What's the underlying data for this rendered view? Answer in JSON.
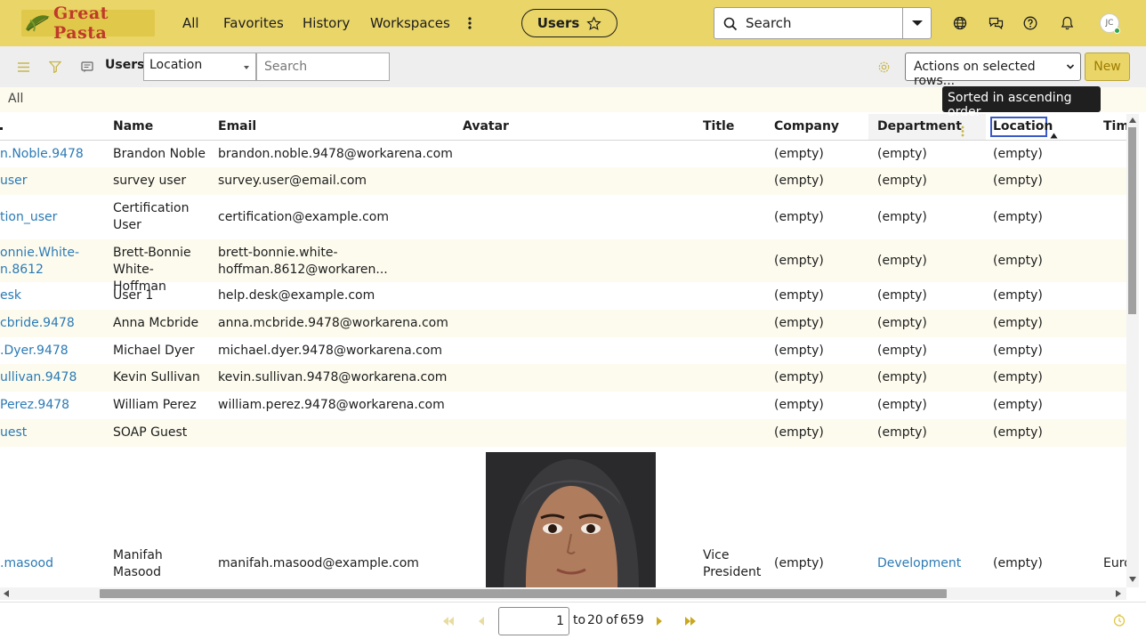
{
  "header": {
    "logo_text": "Great Pasta",
    "nav": [
      "All",
      "Favorites",
      "History",
      "Workspaces"
    ],
    "current_module": "Users",
    "search_placeholder": "Search",
    "user_initials": "JC"
  },
  "listbar": {
    "title": "Users",
    "field_select": "Location",
    "search_placeholder": "Search",
    "actions_label": "Actions on selected rows...",
    "new_label": "New"
  },
  "breadcrumb": "All",
  "tooltip": "Sorted in ascending order",
  "columns": [
    "Name",
    "Email",
    "Avatar",
    "Title",
    "Company",
    "Department",
    "Location",
    "Tim"
  ],
  "rows": [
    {
      "id": "n.Noble.9478",
      "name": "Brandon Noble",
      "email": "brandon.noble.9478@workarena.com",
      "title": "",
      "company": "(empty)",
      "department": "(empty)",
      "location": "(empty)"
    },
    {
      "id": "user",
      "name": "survey user",
      "email": "survey.user@email.com",
      "title": "",
      "company": "(empty)",
      "department": "(empty)",
      "location": "(empty)"
    },
    {
      "id": "tion_user",
      "name": "Certification User",
      "email": "certification@example.com",
      "title": "",
      "company": "(empty)",
      "department": "(empty)",
      "location": "(empty)"
    },
    {
      "id": "onnie.White-n.8612",
      "name": "Brett-Bonnie White-Hoffman",
      "email": "brett-bonnie.white-hoffman.8612@workaren...",
      "title": "",
      "company": "(empty)",
      "department": "(empty)",
      "location": "(empty)"
    },
    {
      "id": "esk",
      "name": "User 1",
      "email": "help.desk@example.com",
      "title": "",
      "company": "(empty)",
      "department": "(empty)",
      "location": "(empty)"
    },
    {
      "id": "cbride.9478",
      "name": "Anna Mcbride",
      "email": "anna.mcbride.9478@workarena.com",
      "title": "",
      "company": "(empty)",
      "department": "(empty)",
      "location": "(empty)"
    },
    {
      "id": ".Dyer.9478",
      "name": "Michael Dyer",
      "email": "michael.dyer.9478@workarena.com",
      "title": "",
      "company": "(empty)",
      "department": "(empty)",
      "location": "(empty)"
    },
    {
      "id": "ullivan.9478",
      "name": "Kevin Sullivan",
      "email": "kevin.sullivan.9478@workarena.com",
      "title": "",
      "company": "(empty)",
      "department": "(empty)",
      "location": "(empty)"
    },
    {
      "id": "Perez.9478",
      "name": "William Perez",
      "email": "william.perez.9478@workarena.com",
      "title": "",
      "company": "(empty)",
      "department": "(empty)",
      "location": "(empty)"
    },
    {
      "id": "uest",
      "name": "SOAP Guest",
      "email": "",
      "title": "",
      "company": "(empty)",
      "department": "(empty)",
      "location": "(empty)"
    },
    {
      "id": ".masood",
      "name": "Manifah Masood",
      "email": "manifah.masood@example.com",
      "title": "Vice President",
      "company": "(empty)",
      "department": "Development",
      "location": "(empty)",
      "time": "Euro"
    }
  ],
  "pager": {
    "page_input": "1",
    "to_label": "to",
    "to_value": "20",
    "of_label": "of",
    "total": "659"
  }
}
